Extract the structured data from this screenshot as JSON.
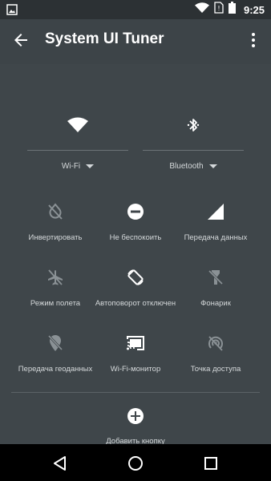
{
  "status_bar": {
    "time": "9:25",
    "icons": [
      "image-icon",
      "wifi-icon",
      "no-sim-icon",
      "battery-icon"
    ]
  },
  "app_bar": {
    "title": "System UI Tuner",
    "back_icon": "arrow-back-icon",
    "menu_icon": "more-vert-icon"
  },
  "big_tiles": [
    {
      "label": "Wi-Fi",
      "icon": "wifi-icon"
    },
    {
      "label": "Bluetooth",
      "icon": "bluetooth-icon"
    }
  ],
  "tiles": [
    {
      "label": "Инвертировать",
      "icon": "invert-colors-off-icon"
    },
    {
      "label": "Не беспокоить",
      "icon": "do-not-disturb-icon"
    },
    {
      "label": "Передача данных",
      "icon": "cellular-signal-icon"
    },
    {
      "label": "Режим полета",
      "icon": "airplane-icon"
    },
    {
      "label": "Автоповорот отключен",
      "icon": "screen-rotation-icon"
    },
    {
      "label": "Фонарик",
      "icon": "flashlight-off-icon"
    },
    {
      "label": "Передача геоданных",
      "icon": "location-off-icon"
    },
    {
      "label": "Wi-Fi-монитор",
      "icon": "cast-icon"
    },
    {
      "label": "Точка доступа",
      "icon": "hotspot-off-icon"
    }
  ],
  "add_tile": {
    "label": "Добавить кнопку",
    "icon": "add-circle-icon"
  },
  "nav_bar": {
    "icons": [
      "back-triangle-icon",
      "home-circle-icon",
      "recents-square-icon"
    ]
  },
  "colors": {
    "background": "#3f464a",
    "status_bar": "#2c3134",
    "nav_bar": "#000000",
    "label": "#d4d8da",
    "icon_dim": "#8a9195"
  }
}
